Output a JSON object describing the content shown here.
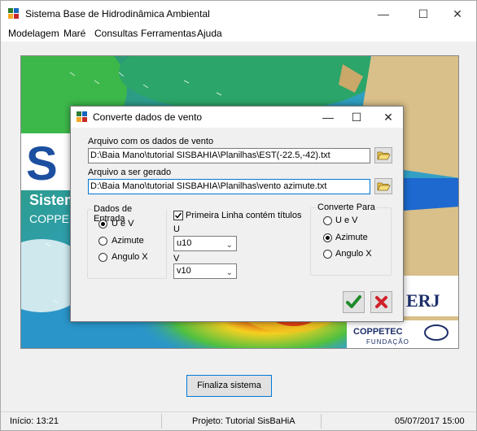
{
  "window": {
    "title": "Sistema Base de Hidrodinâmica Ambiental",
    "controls": {
      "minimize": "—",
      "maximize": "☐",
      "close": "✕"
    }
  },
  "menu": [
    "Modelagem",
    "Maré",
    "Consultas",
    "Ferramentas",
    "Ajuda"
  ],
  "splash": {
    "logo_letters": "S",
    "subtitle_line1": "Sistem",
    "subtitle_line2": "COPPE -",
    "partner_logo": "ERJ",
    "partner_small": "UFRJ",
    "coppetec": "COPPETEC",
    "fundacao": "FUNDAÇÃO"
  },
  "finaliza_button": "Finaliza sistema",
  "status": {
    "inicio": "Início: 13:21",
    "projeto": "Projeto: Tutorial SisBaHiA",
    "data": "05/07/2017 15:00"
  },
  "dialog": {
    "title": "Converte dados de vento",
    "controls": {
      "minimize": "—",
      "maximize": "☐",
      "close": "✕"
    },
    "input_file_label": "Arquivo com os dados de vento",
    "input_file_value": "D:\\Baia Mano\\tutorial SISBAHIA\\Planilhas\\EST(-22.5,-42).txt",
    "output_file_label": "Arquivo a ser gerado",
    "output_file_value": "D:\\Baia Mano\\tutorial SISBAHIA\\Planilhas\\vento azimute.txt",
    "dados_entrada": {
      "title": "Dados de Entrada",
      "options": [
        "U e V",
        "Azimute",
        "Angulo X"
      ],
      "selected": 0
    },
    "primeira_linha_label": "Primeira Linha contém títulos",
    "primeira_linha_checked": true,
    "u_label": "U",
    "u_value": "u10",
    "v_label": "V",
    "v_value": "v10",
    "converte_para": {
      "title": "Converte Para",
      "options": [
        "U e V",
        "Azimute",
        "Angulo X"
      ],
      "selected": 1
    },
    "ok_icon": "check-icon",
    "cancel_icon": "cross-icon"
  },
  "colors": {
    "ok_green": "#1f8a2a",
    "cancel_red": "#d0202a",
    "accent": "#0078d7"
  }
}
